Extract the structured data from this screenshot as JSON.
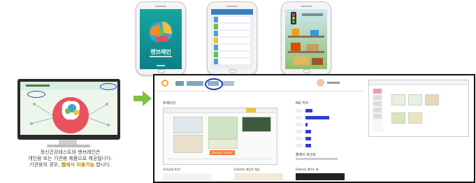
{
  "caption": {
    "line1": "정신건강테스트와 멘브레인은",
    "line2": "개인용 또는 기관용 제품으로 제공됩니다.",
    "line3_prefix": "기관용의 경우,",
    "line3_highlight": "웹에서 이용가능",
    "line3_suffix": "합니다."
  },
  "phones": {
    "splash_title": "멘브레인"
  },
  "web_app": {
    "nav_tabs": [
      "",
      "",
      "",
      ""
    ],
    "left_section_title": "트레이닝",
    "right_section_title": "NQ 지수",
    "ranking_title": "플레이 포인트",
    "play_button": "Display Game?",
    "bottom_labels": [
      "유의깊게 하자?",
      "Enbrain 게임의 개념",
      "Enbrain 웨이스 룩"
    ]
  },
  "colors": {
    "accent_green": "#7fc241",
    "bar_blue": "#2f3fd0",
    "highlight_circle": "#2438c8",
    "orange_button": "#f47a3a"
  }
}
